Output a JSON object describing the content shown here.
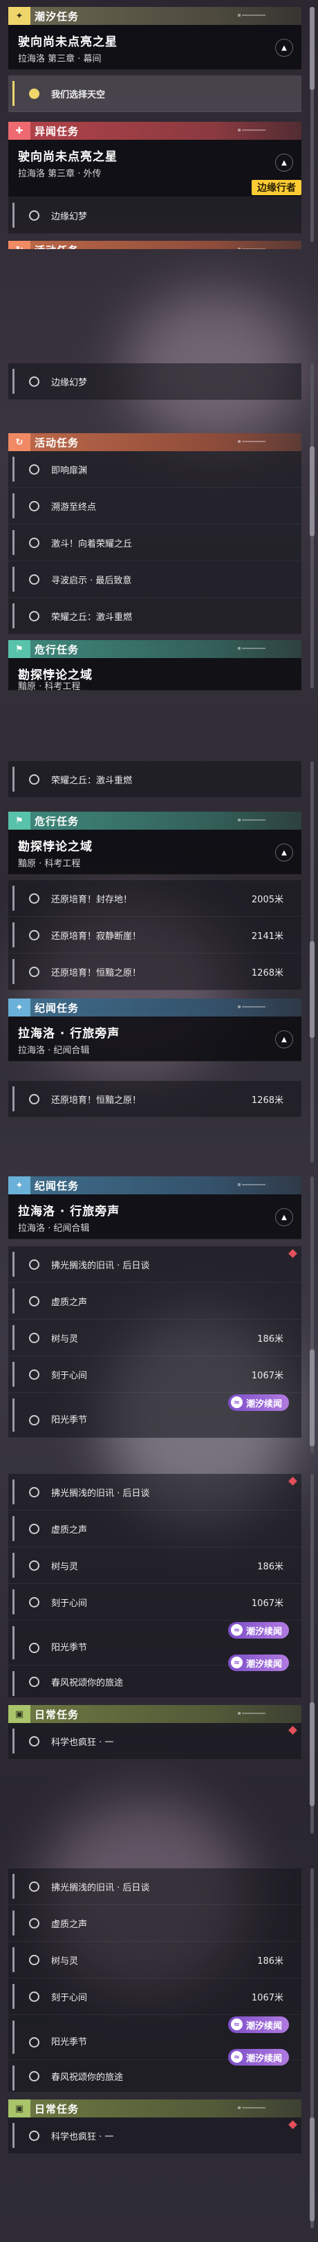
{
  "categories": {
    "tide": "潮汐任务",
    "anomaly": "异闻任务",
    "activity": "活动任务",
    "danger": "危行任务",
    "chronicle": "纪闻任务",
    "daily": "日常任务"
  },
  "quests": {
    "q1": {
      "title": "驶向尚未点亮之星",
      "subtitle": "拉海洛 第三章 · 幕间"
    },
    "q2": {
      "title": "驶向尚未点亮之星",
      "subtitle": "拉海洛 第三章 · 外传"
    },
    "q3": {
      "title": "勘探悖论之域",
      "subtitle": "黯原 · 科考工程"
    },
    "q4": {
      "title": "拉海洛 · 行旅旁声",
      "subtitle": "拉海洛 · 纪闻合辑"
    }
  },
  "tasks": {
    "choose": "我们选择天空",
    "fantasy": "边缘幻梦",
    "echo": "即响扉渊",
    "endpoint": "溯游至终点",
    "fight": "激斗！向着荣耀之丘",
    "seek": "寻波启示 · 最后致意",
    "glory": "荣耀之丘：激斗重燃",
    "restore1": "还原培育！封存地！",
    "restore2": "还原培育！寂静断崖！",
    "restore3": "还原培育！恒黯之原！",
    "news": "拂光搁浅的旧讯 · 后日谈",
    "ghost": "虚质之声",
    "tree": "树与灵",
    "heart": "刻于心间",
    "sun": "阳光季节",
    "spring": "春风祝颂你的旅途",
    "science": "科学也疯狂 · 一"
  },
  "distances": {
    "d1": "2005米",
    "d2": "2141米",
    "d3": "1268米",
    "d4": "186米",
    "d5": "1067米"
  },
  "badges": {
    "tide_story": "潮汐续闻"
  },
  "tags": {
    "edge_walker": "边缘行者"
  },
  "icons": {
    "arrow": "chevron-up-icon"
  }
}
